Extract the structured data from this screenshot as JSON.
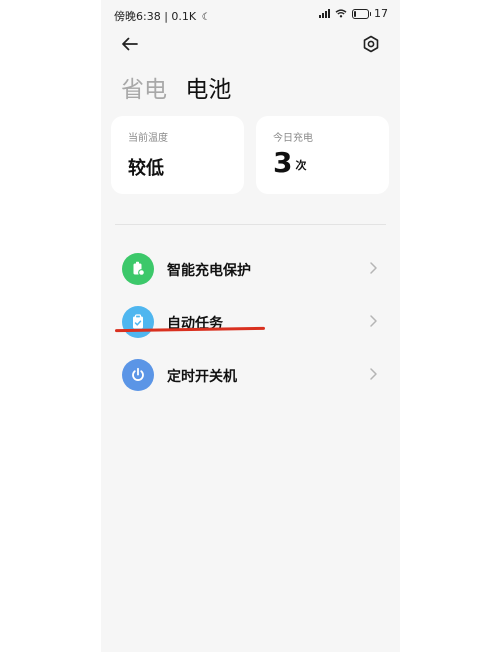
{
  "status_bar": {
    "time": "傍晚6:38",
    "separator": "|",
    "network_speed": "0.1K",
    "battery_level": "17",
    "battery_fraction": 0.17
  },
  "header": {
    "tab_inactive": "省电",
    "tab_active": "电池"
  },
  "cards": {
    "temperature": {
      "label": "当前温度",
      "value": "较低"
    },
    "charge": {
      "label": "今日充电",
      "value": "3",
      "unit": "次"
    }
  },
  "menu": {
    "items": [
      {
        "label": "智能充电保护",
        "icon": "battery-shield-icon",
        "color": "#3cc86a"
      },
      {
        "label": "自动任务",
        "icon": "clipboard-icon",
        "color": "#4fb6ef"
      },
      {
        "label": "定时开关机",
        "icon": "power-icon",
        "color": "#5b95e6"
      }
    ]
  },
  "colors": {
    "annotation_line": "#d9301f",
    "background": "#f6f6f6"
  }
}
